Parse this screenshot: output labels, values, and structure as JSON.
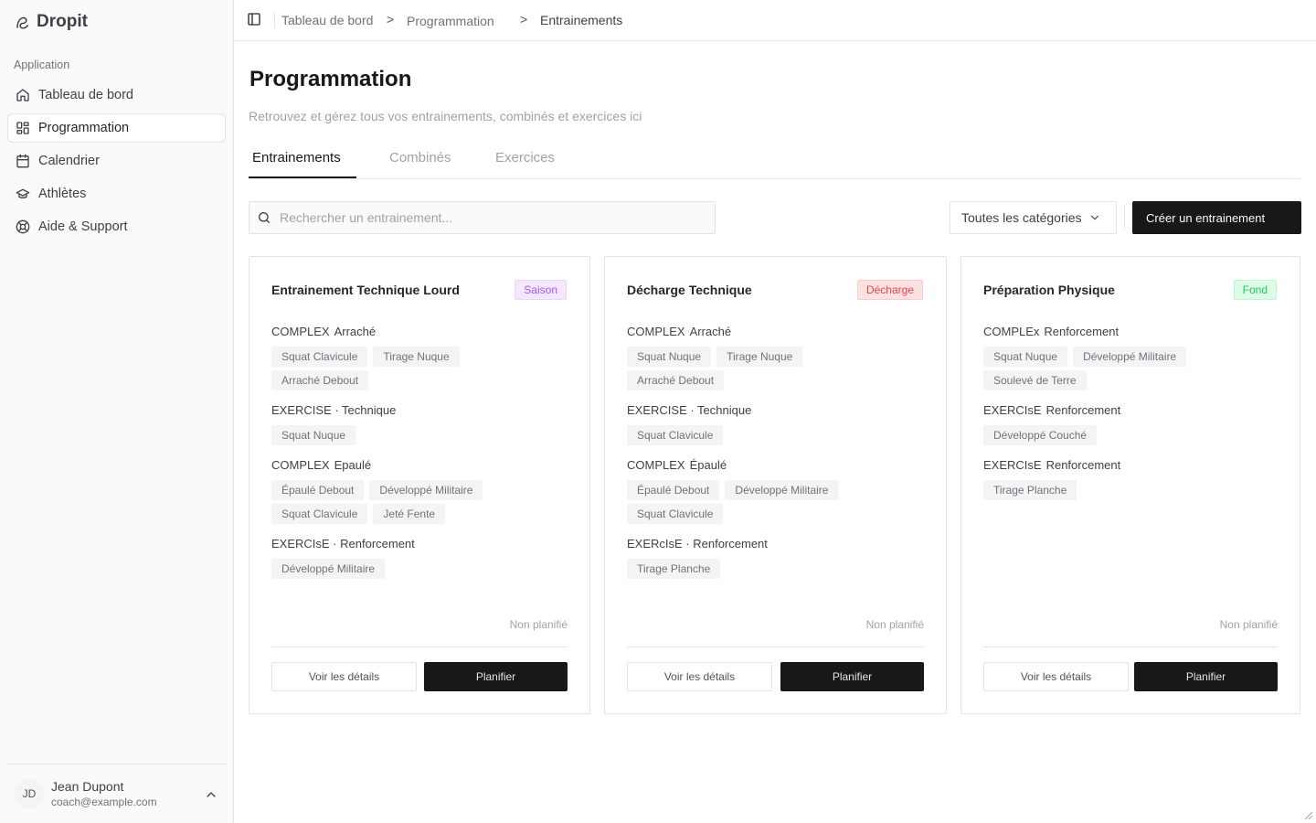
{
  "app": {
    "name": "Dropit"
  },
  "sidebar": {
    "group_label": "Application",
    "items": [
      {
        "label": "Tableau de bord",
        "icon": "home-icon"
      },
      {
        "label": "Programmation",
        "icon": "grid-icon"
      },
      {
        "label": "Calendrier",
        "icon": "calendar-icon"
      },
      {
        "label": "Athlètes",
        "icon": "graduation-cap-icon"
      },
      {
        "label": "Aide & Support",
        "icon": "life-buoy-icon"
      }
    ],
    "user": {
      "initials": "JD",
      "name": "Jean Dupont",
      "email": "coach@example.com"
    }
  },
  "breadcrumb": [
    "Tableau de bord",
    "Programmation",
    "Entrainements"
  ],
  "page": {
    "title": "Programmation",
    "subtitle": "Retrouvez et gérez tous vos entrainements, combinés et exercices ici"
  },
  "tabs": [
    "Entrainements",
    "Combinés",
    "Exercices"
  ],
  "toolbar": {
    "search_placeholder": "Rechercher un entrainement...",
    "category_select": "Toutes les catégories",
    "create_label": "Créer un entrainement"
  },
  "cards": [
    {
      "title": "Entrainement Technique Lourd",
      "badge": "Saison",
      "blocks": [
        {
          "kind": "COMPLEX",
          "name": "Arraché",
          "items": [
            "Squat Clavicule",
            "Tirage Nuque",
            "Arraché Debout"
          ]
        },
        {
          "kind": "EXERCISE · Technique",
          "name": "",
          "items": [
            "Squat Nuque"
          ]
        },
        {
          "kind": "COMPLEX",
          "name": "Epaulé",
          "items": [
            "Épaulé Debout",
            "Développé Militaire",
            "Squat Clavicule",
            "Jeté Fente"
          ]
        },
        {
          "kind": "EXERCIsE · Renforcement",
          "name": "",
          "items": [
            "Développé Militaire"
          ]
        }
      ],
      "status": "Non planifié",
      "details_label": "Voir les détails",
      "plan_label": "Planifier"
    },
    {
      "title": "Décharge Technique",
      "badge": "Décharge",
      "blocks": [
        {
          "kind": "COMPLEX",
          "name": "Arraché",
          "items": [
            "Squat Nuque",
            "Tirage Nuque",
            "Arraché Debout"
          ]
        },
        {
          "kind": "EXERCISE · Technique",
          "name": "",
          "items": [
            "Squat Clavicule"
          ]
        },
        {
          "kind": "COMPLEX",
          "name": "Épaulé",
          "items": [
            "Épaulé Debout",
            "Développé Militaire",
            "Squat Clavicule"
          ]
        },
        {
          "kind": "EXERcIsE · Renforcement",
          "name": "",
          "items": [
            "Tirage Planche"
          ]
        }
      ],
      "status": "Non planifié",
      "details_label": "Voir les détails",
      "plan_label": "Planifier"
    },
    {
      "title": "Préparation Physique",
      "badge": "Fond",
      "blocks": [
        {
          "kind": "COMPLEx",
          "name": "Renforcement",
          "items": [
            "Squat Nuque",
            "Développé Militaire",
            "Soulevé de Terre"
          ]
        },
        {
          "kind": "EXERCIsE",
          "name": "Renforcement",
          "items": [
            "Développé Couché"
          ]
        },
        {
          "kind": "EXERCIsE",
          "name": "Renforcement",
          "items": [
            "Tirage Planche"
          ]
        }
      ],
      "status": "Non planifié",
      "details_label": "Voir les détails",
      "plan_label": "Planifier"
    }
  ],
  "colors": {
    "primary": "#18181b",
    "badge_saison": "#a855f7",
    "badge_decharge": "#ef4444",
    "badge_fond": "#22c55e"
  }
}
